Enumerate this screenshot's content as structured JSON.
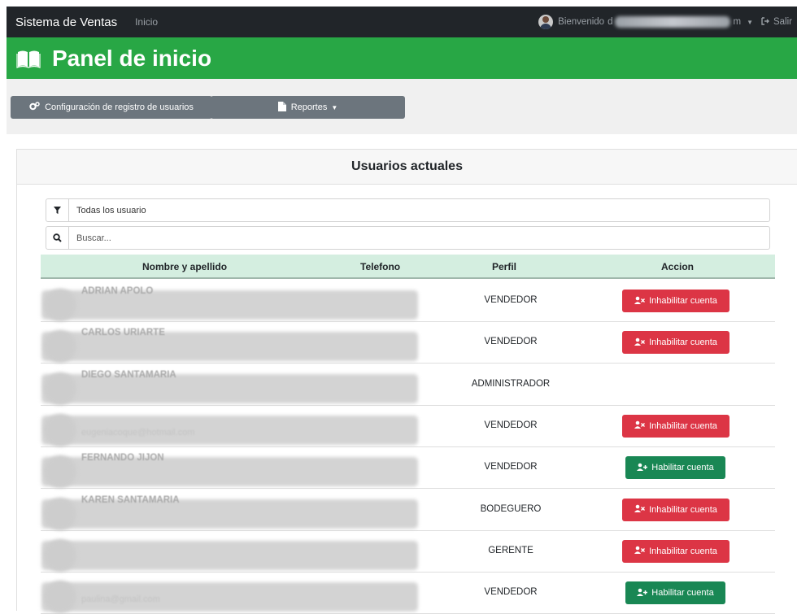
{
  "navbar": {
    "brand": "Sistema de Ventas",
    "home_link": "Inicio",
    "welcome": "Bienvenido",
    "email_visible_start": "d",
    "email_visible_end": "m",
    "logout": "Salir"
  },
  "header": {
    "title": "Panel de inicio"
  },
  "toolbar": {
    "config_label": "Configuración de registro de usuarios",
    "reports_label": "Reportes"
  },
  "card": {
    "title": "Usuarios actuales",
    "filter_value": "Todas los usuario",
    "search_placeholder": "Buscar..."
  },
  "table": {
    "headers": [
      "Nombre y apellido",
      "Telefono",
      "Perfil",
      "Accion"
    ],
    "rows": [
      {
        "name": "ADRIAN APOLO",
        "email": "",
        "profile": "VENDEDOR",
        "action": "Inhabilitar cuenta",
        "action_type": "disable"
      },
      {
        "name": "CARLOS URIARTE",
        "email": "",
        "profile": "VENDEDOR",
        "action": "Inhabilitar cuenta",
        "action_type": "disable"
      },
      {
        "name": "DIEGO SANTAMARIA",
        "email": "",
        "profile": "ADMINISTRADOR",
        "action": "",
        "action_type": "none"
      },
      {
        "name": "",
        "email": "eugeniacoque@hotmail.com",
        "profile": "VENDEDOR",
        "action": "Inhabilitar cuenta",
        "action_type": "disable"
      },
      {
        "name": "FERNANDO JIJON",
        "email": "",
        "profile": "VENDEDOR",
        "action": "Habilitar cuenta",
        "action_type": "enable"
      },
      {
        "name": "KAREN SANTAMARIA",
        "email": "",
        "profile": "BODEGUERO",
        "action": "Inhabilitar cuenta",
        "action_type": "disable"
      },
      {
        "name": "",
        "email": "",
        "profile": "GERENTE",
        "action": "Inhabilitar cuenta",
        "action_type": "disable"
      },
      {
        "name": "",
        "email": "paulina@gmail.com",
        "profile": "VENDEDOR",
        "action": "Habilitar cuenta",
        "action_type": "enable"
      }
    ]
  },
  "icons": {
    "filter": "filter-icon",
    "search": "search-icon",
    "book": "book-icon",
    "config": "cogs-icon",
    "reports": "file-icon",
    "user_disable": "user-times-icon",
    "user_enable": "user-plus-icon",
    "logout": "sign-out-icon"
  },
  "colors": {
    "navbar_bg": "#212529",
    "header_green": "#28a745",
    "danger": "#dc3545",
    "success": "#198754",
    "secondary": "#6c757d",
    "table_header": "#d4eee0"
  }
}
